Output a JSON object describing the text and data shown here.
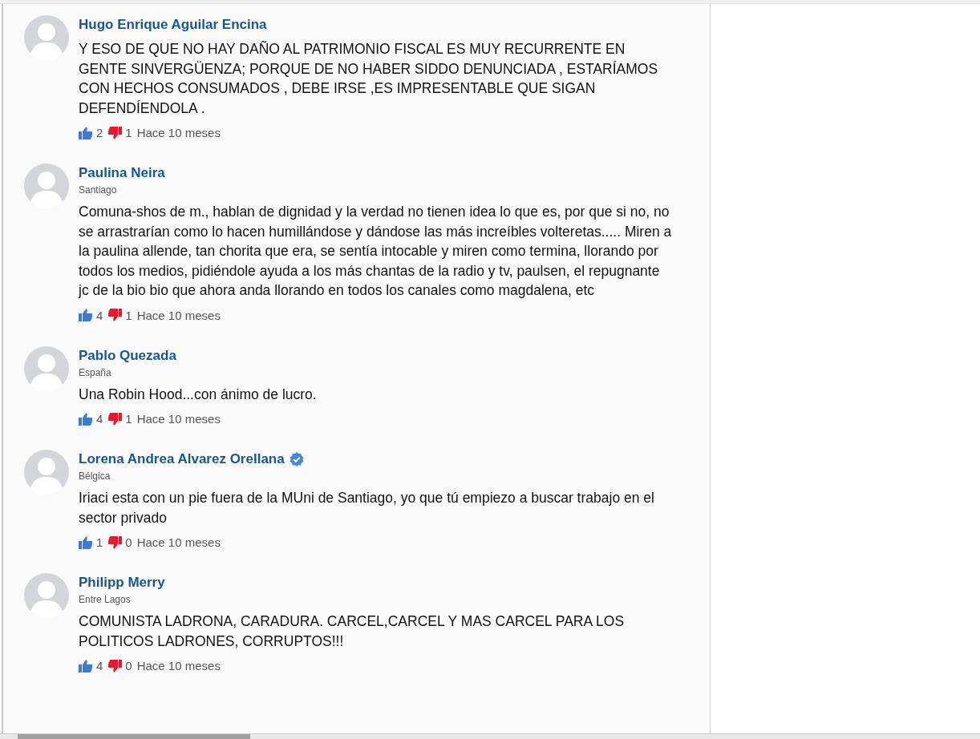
{
  "comments": [
    {
      "author": "Hugo Enrique Aguilar Encina",
      "verified": false,
      "body": "Y ESO DE QUE NO HAY DAÑO AL PATRIMONIO FISCAL ES MUY RECURRENTE EN GENTE SINVERGÜENZA; PORQUE DE NO HABER SIDDO DENUNCIADA , ESTARÍAMOS CON HECHOS CONSUMADOS , DEBE IRSE ,ES IMPRESENTABLE QUE SIGAN DEFENDÍENDOLA .",
      "likes": "2",
      "dislikes": "1",
      "time": "Hace 10 meses"
    },
    {
      "author": "Paulina Neira",
      "verified": false,
      "location": "Santiago",
      "body": "Comuna-shos de m., hablan de dignidad y la verdad no tienen idea lo que es, por que si no, no se arrastrarían como lo hacen humillándose y dándose las más increíbles volteretas..... Miren a la paulina allende, tan chorita que era, se sentía intocable y miren como termina, llorando por todos los medios, pidiéndole ayuda a los más chantas de la radio y tv, paulsen, el repugnante jc de la bio bio que ahora anda llorando en todos los canales como magdalena, etc",
      "likes": "4",
      "dislikes": "1",
      "time": "Hace 10 meses"
    },
    {
      "author": "Pablo Quezada",
      "verified": false,
      "location": "España",
      "body": "Una Robin Hood...con ánimo de lucro.",
      "likes": "4",
      "dislikes": "1",
      "time": "Hace 10 meses"
    },
    {
      "author": "Lorena Andrea Alvarez Orellana",
      "verified": true,
      "location": "Bélgica",
      "body": "Iriaci esta con un pie fuera de la MUni de Santiago, yo que tú empiezo a buscar trabajo en el sector privado",
      "likes": "1",
      "dislikes": "0",
      "time": "Hace 10 meses"
    },
    {
      "author": "Philipp Merry",
      "verified": false,
      "location": "Entre Lagos",
      "body": "COMUNISTA LADRONA, CARADURA. CARCEL,CARCEL Y MAS CARCEL PARA LOS POLITICOS LADRONES, CORRUPTOS!!!",
      "likes": "4",
      "dislikes": "0",
      "time": "Hace 10 meses"
    }
  ]
}
